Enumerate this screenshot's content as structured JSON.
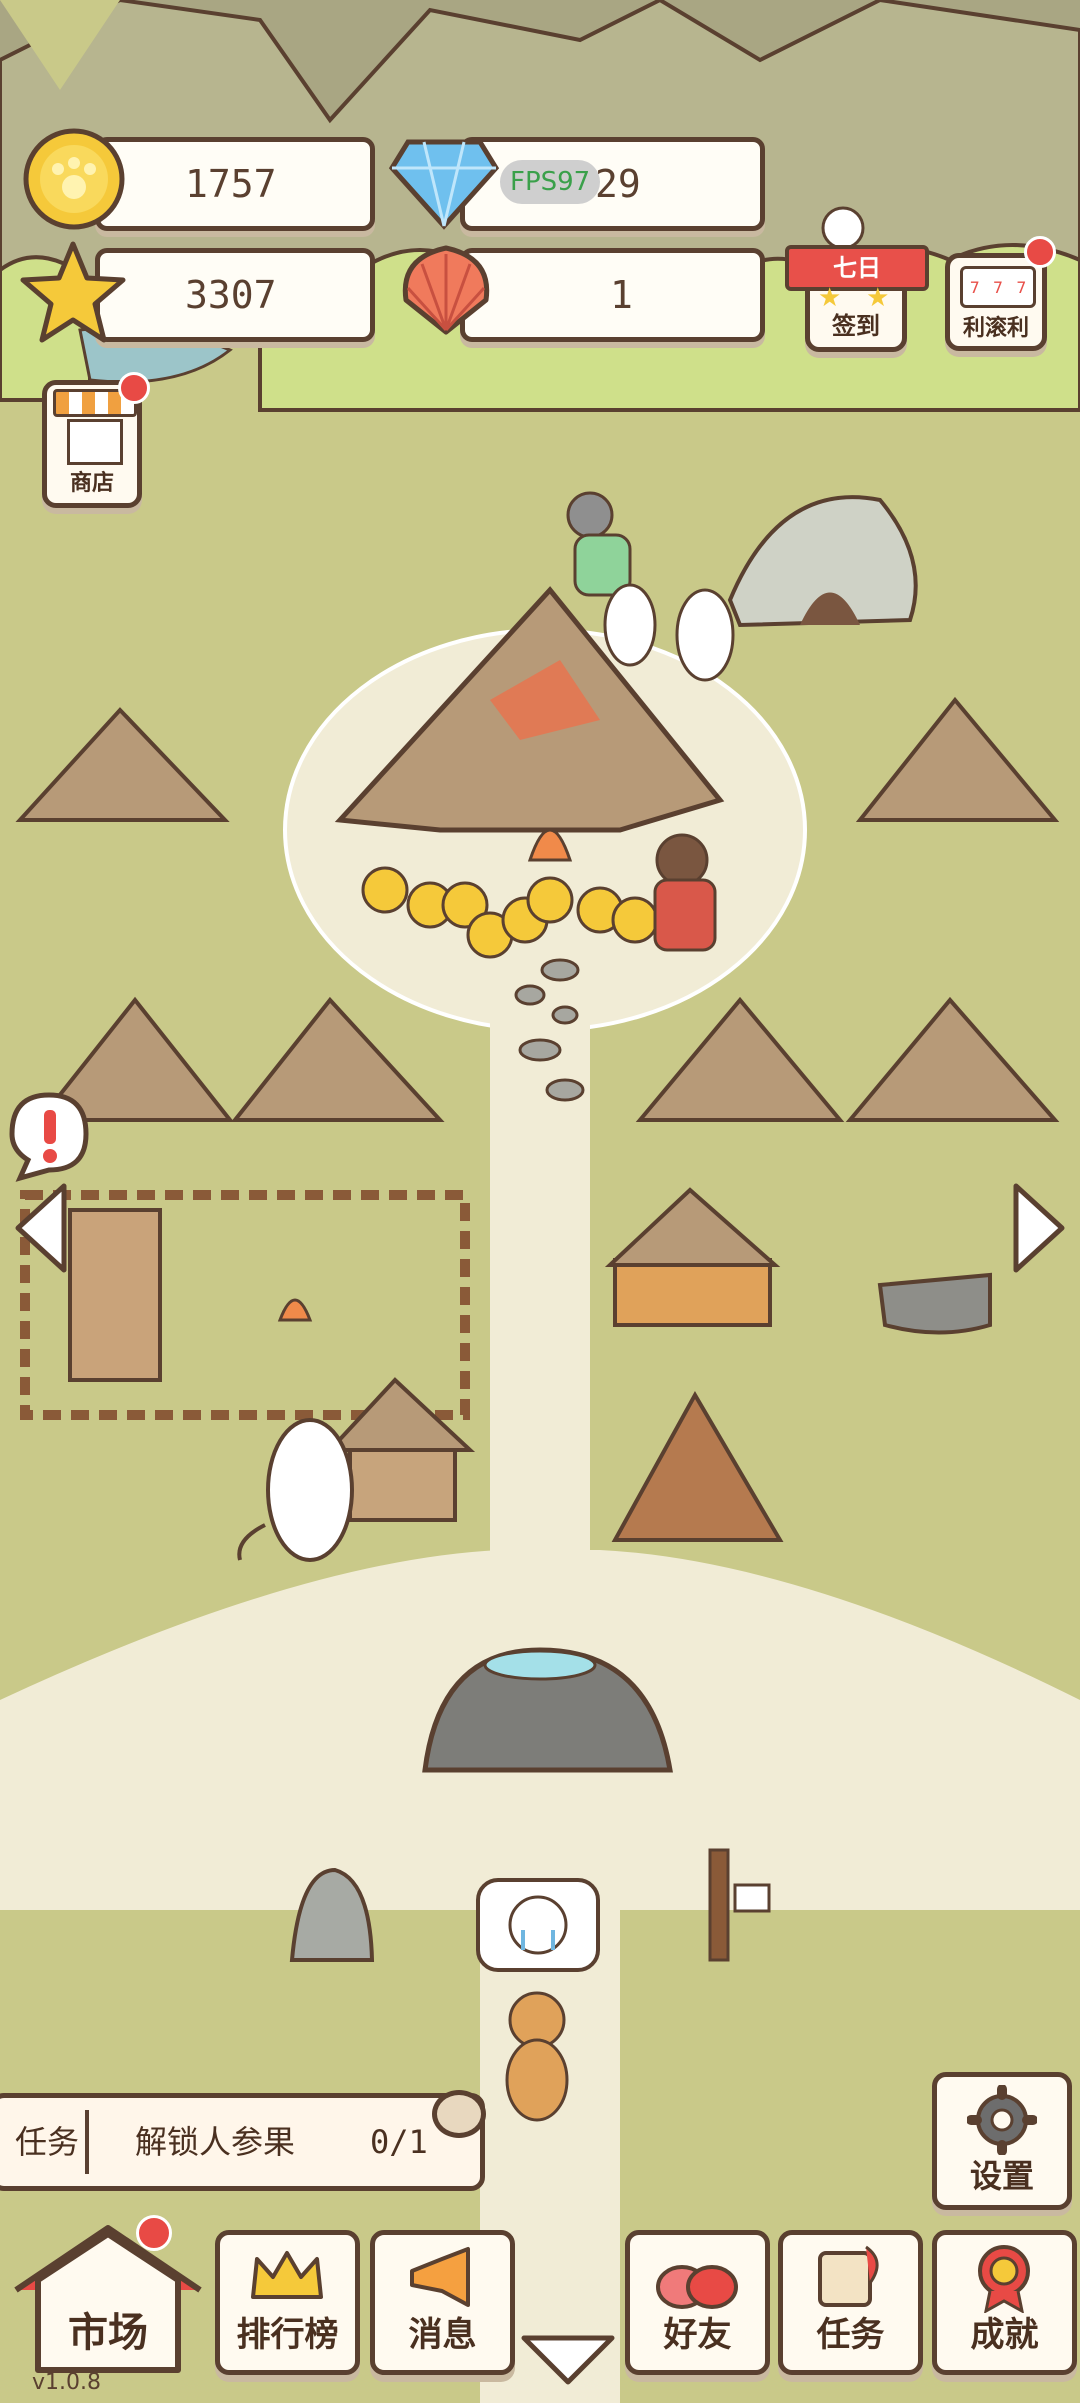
{
  "resources": {
    "coins": "1757",
    "diamonds": "29",
    "fps_overlay": "FPS97",
    "stars": "3307",
    "shells": "1"
  },
  "top_buttons": {
    "checkin_banner": "七日",
    "checkin_label": "签到",
    "slots_label": "利滚利",
    "shop_label": "商店"
  },
  "task": {
    "prefix": "任务",
    "text": "解锁人参果",
    "progress": "0/1"
  },
  "settings_label": "设置",
  "nav": {
    "market": "市场",
    "ranking": "排行榜",
    "messages": "消息",
    "friends": "好友",
    "tasks": "任务",
    "achievements": "成就"
  },
  "version": "v1.0.8",
  "colors": {
    "grass": "#c9c989",
    "path": "#f1ecd6",
    "outline": "#5a4030",
    "notify_red": "#e84a45"
  }
}
